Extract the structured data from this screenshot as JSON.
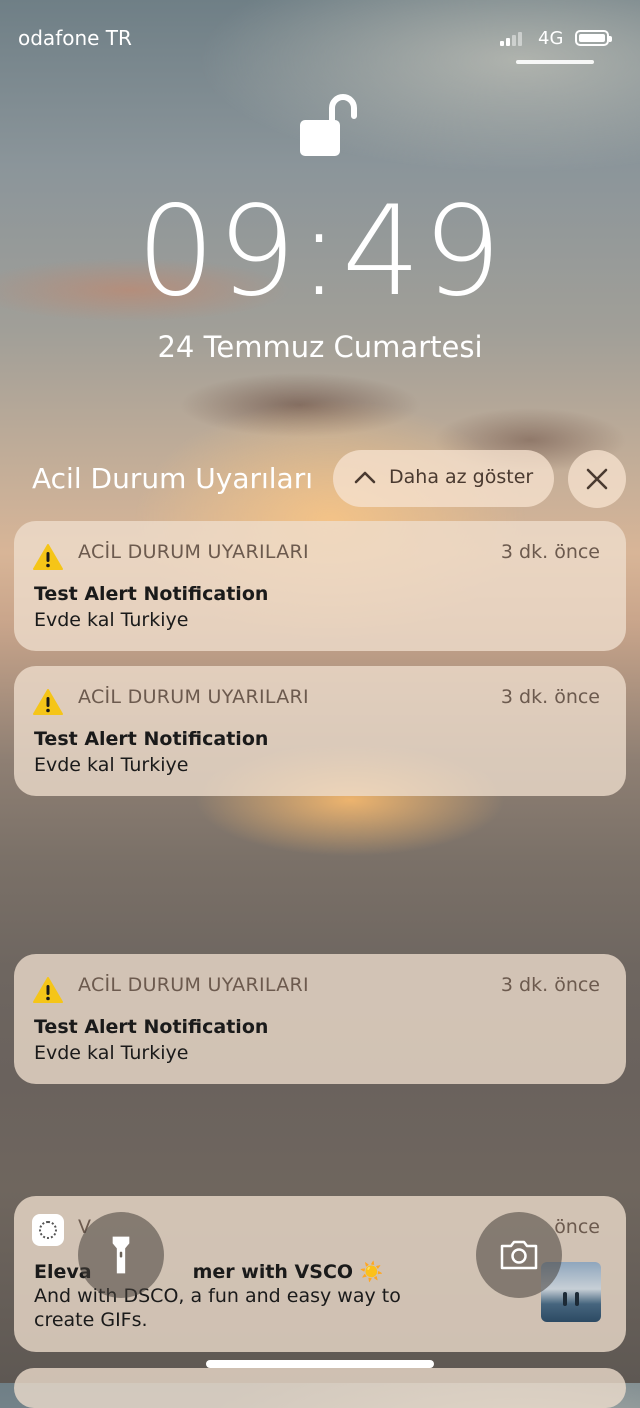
{
  "status_bar": {
    "carrier": "odafone TR",
    "network": "4G",
    "signal_bars": 2,
    "battery_level": 1.0
  },
  "lockscreen": {
    "lock_icon": "unlocked-padlock-icon",
    "time": "09:49",
    "date": "24 Temmuz Cumartesi"
  },
  "group": {
    "title": "Acil Durum Uyarıları",
    "collapse_label": "Daha az göster",
    "collapse_icon": "chevron-up-icon",
    "clear_icon": "close-icon"
  },
  "notifications": [
    {
      "app": "ACİL DURUM UYARILARI",
      "time_ago": "3 dk. önce",
      "title": "Test Alert Notification",
      "body": "Evde kal Turkiye",
      "icon": "warning-icon"
    },
    {
      "app": "ACİL DURUM UYARILARI",
      "time_ago": "3 dk. önce",
      "title": "Test Alert Notification",
      "body": "Evde kal Turkiye",
      "icon": "warning-icon"
    },
    {
      "app": "ACİL DURUM UYARILARI",
      "time_ago": "3 dk. önce",
      "title": "Test Alert Notification",
      "body": "Evde kal Turkiye",
      "icon": "warning-icon"
    }
  ],
  "vsco_notification": {
    "app": "V",
    "time_ago": "önce",
    "title_start": "Eleva",
    "title_end": "mer with VSCO ☀️",
    "body": "And with DSCO, a fun and easy way to create GIFs.",
    "icon": "vsco-icon",
    "thumbnail": "beach-photo-thumbnail"
  },
  "quick_actions": {
    "flashlight_icon": "flashlight-icon",
    "camera_icon": "camera-icon"
  },
  "colors": {
    "card_bg": "#EEDECD",
    "warning_yellow": "#F5C518",
    "meta_text": "#6C5A4E"
  }
}
